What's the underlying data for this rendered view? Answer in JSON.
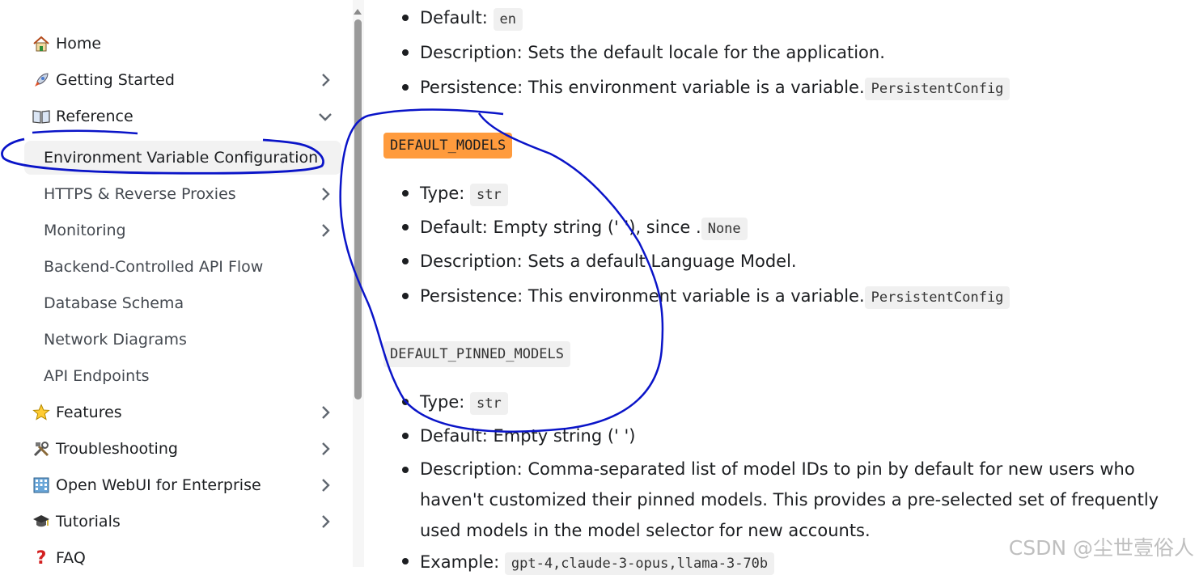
{
  "sidebar": {
    "items": [
      {
        "label": "Home",
        "icon": "house-icon",
        "chevron": "none"
      },
      {
        "label": "Getting Started",
        "icon": "rocket-icon",
        "chevron": "right"
      },
      {
        "label": "Reference",
        "icon": "open-book-icon",
        "chevron": "down"
      },
      {
        "label": "Environment Variable Configuration",
        "active": true
      },
      {
        "label": "HTTPS & Reverse Proxies",
        "chevron": "right"
      },
      {
        "label": "Monitoring",
        "chevron": "right"
      },
      {
        "label": "Backend-Controlled API Flow"
      },
      {
        "label": "Database Schema"
      },
      {
        "label": "Network Diagrams"
      },
      {
        "label": "API Endpoints"
      },
      {
        "label": "Features",
        "icon": "star-icon",
        "chevron": "right"
      },
      {
        "label": "Troubleshooting",
        "icon": "tools-icon",
        "chevron": "right"
      },
      {
        "label": "Open WebUI for Enterprise",
        "icon": "office-building-icon",
        "chevron": "right"
      },
      {
        "label": "Tutorials",
        "icon": "graduation-cap-icon",
        "chevron": "right"
      },
      {
        "label": "FAQ",
        "icon": "question-mark-icon"
      }
    ]
  },
  "content": {
    "prev": {
      "default_label": "Default:",
      "default_code": "en",
      "description": "Description: Sets the default locale for the application.",
      "persistence_text": "Persistence: This environment variable is a variable.",
      "persistence_code": "PersistentConfig"
    },
    "default_models": {
      "heading": "DEFAULT_MODELS",
      "type_label": "Type:",
      "type_code": "str",
      "default_text": "Default: Empty string (' '), since .",
      "default_code": "None",
      "description": "Description: Sets a default Language Model.",
      "persistence_text": "Persistence: This environment variable is a variable.",
      "persistence_code": "PersistentConfig"
    },
    "default_pinned_models": {
      "heading": "DEFAULT_PINNED_MODELS",
      "type_label": "Type:",
      "type_code": "str",
      "default_text": "Default: Empty string (' ')",
      "description": "Description: Comma-separated list of model IDs to pin by default for new users who haven't customized their pinned models. This provides a pre-selected set of frequently used models in the model selector for new accounts.",
      "example_label": "Example:",
      "example_code": "gpt-4,claude-3-opus,llama-3-70b"
    }
  },
  "watermark": "CSDN @尘世壹俗人",
  "colors": {
    "highlight": "#ff9b3d",
    "annotation_ink": "#0a14c8",
    "active_bg": "#f2f2f2",
    "code_bg": "#f0f0f0"
  }
}
